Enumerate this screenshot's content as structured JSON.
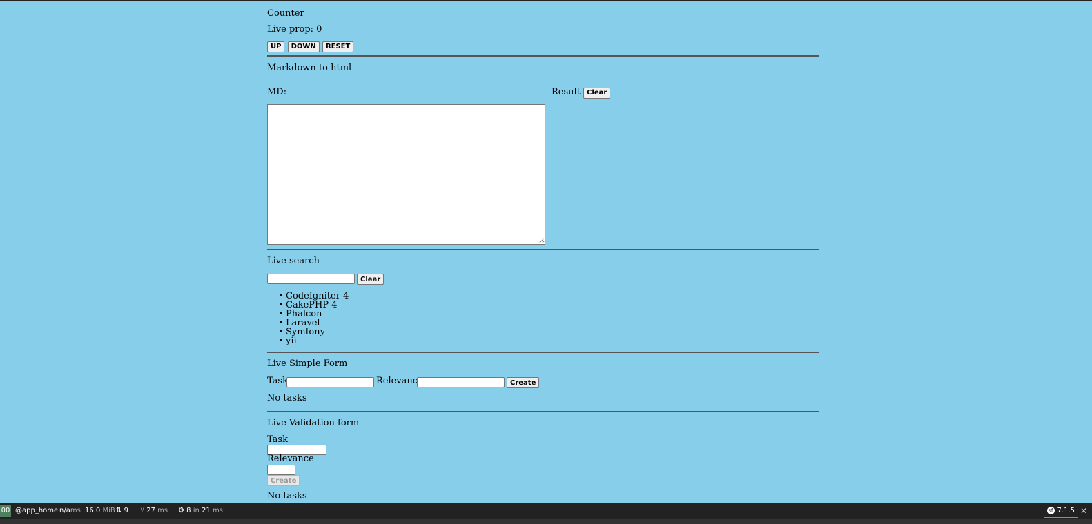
{
  "counter": {
    "title": "Counter",
    "live_prop": "Live prop: 0",
    "buttons": {
      "up": "UP",
      "down": "DOWN",
      "reset": "RESET"
    }
  },
  "markdown": {
    "title": "Markdown to html",
    "md_label": "MD:",
    "result_label": "Result",
    "clear_label": "Clear",
    "textarea_value": ""
  },
  "search": {
    "title": "Live search",
    "input_value": "",
    "clear_label": "Clear",
    "results": [
      "CodeIgniter 4",
      "CakePHP 4",
      "Phalcon",
      "Laravel",
      "Symfony",
      "yii"
    ]
  },
  "simple_form": {
    "title": "Live Simple Form",
    "task_label": "Task",
    "relevance_label": "Relevance",
    "create_label": "Create",
    "empty_text": "No tasks"
  },
  "validation_form": {
    "title": "Live Validation form",
    "task_label": "Task",
    "relevance_label": "Relevance",
    "create_label": "Create",
    "empty_text": "No tasks"
  },
  "toolbar": {
    "status_code": "00",
    "route": "@app_home",
    "time_value": "n/a",
    "time_unit": "ms",
    "memory_value": "16.0",
    "memory_unit": "MiB",
    "requests_count": "9",
    "events_value": "27",
    "events_unit": "ms",
    "listeners_value": "8",
    "listeners_in": "in",
    "listeners_time": "21",
    "listeners_unit": "ms",
    "symfony_version": "7.1.5",
    "colors": {
      "background": "#222222",
      "status": "#4F805D",
      "accent": "#ff5a7a"
    }
  }
}
